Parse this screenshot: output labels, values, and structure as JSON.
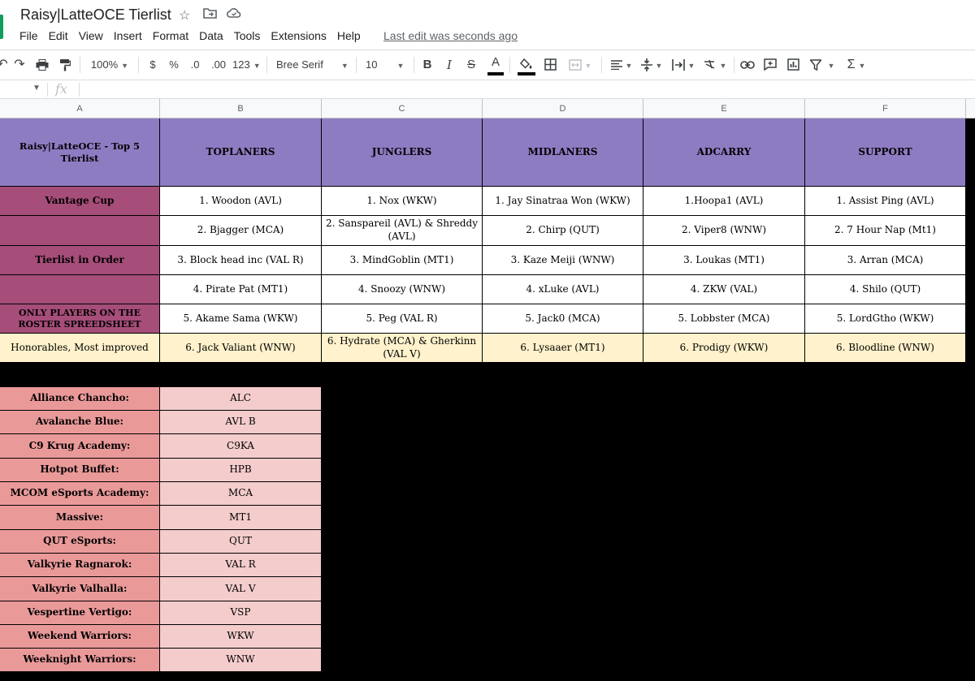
{
  "app": {
    "doc_title": "Raisy|LatteOCE Tierlist",
    "menu": [
      "File",
      "Edit",
      "View",
      "Insert",
      "Format",
      "Data",
      "Tools",
      "Extensions",
      "Help"
    ],
    "last_edit": "Last edit was seconds ago",
    "title_icons": [
      "star-icon",
      "move-to-folder-icon",
      "cloud-saved-icon"
    ]
  },
  "toolbar": {
    "zoom": "100%",
    "currency": "$",
    "percent": "%",
    "dec_decrease": ".0",
    "dec_increase": ".00",
    "more_formats": "123",
    "font": "Bree Serif",
    "font_size": "10"
  },
  "columns": [
    "A",
    "B",
    "C",
    "D",
    "E",
    "F"
  ],
  "sheet": {
    "header": {
      "title": "Raisy|LatteOCE - Top 5 Tierlist",
      "roles": [
        "TOPLANERS",
        "JUNGLERS",
        "MIDLANERS",
        "ADCARRY",
        "SUPPORT"
      ]
    },
    "rows": [
      {
        "label": "Vantage Cup",
        "cells": [
          "1. Woodon (AVL)",
          "1. Nox (WKW)",
          "1. Jay Sinatraa Won (WKW)",
          "1.Hoopa1 (AVL)",
          "1. Assist Ping (AVL)"
        ]
      },
      {
        "label": "",
        "cells": [
          "2. Bjagger (MCA)",
          "2. Sanspareil (AVL) & Shreddy (AVL)",
          "2. Chirp (QUT)",
          "2. Viper8 (WNW)",
          "2. 7 Hour Nap (Mt1)"
        ]
      },
      {
        "label": "Tierlist in Order",
        "cells": [
          "3. Block head inc (VAL R)",
          "3. MindGoblin (MT1)",
          "3. Kaze Meiji (WNW)",
          "3. Loukas (MT1)",
          "3. Arran (MCA)"
        ]
      },
      {
        "label": "",
        "cells": [
          "4. Pirate Pat (MT1)",
          "4. Snoozy (WNW)",
          "4. xLuke (AVL)",
          "4. ZKW (VAL)",
          "4. Shilo (QUT)"
        ]
      },
      {
        "label": "ONLY PLAYERS ON THE ROSTER SPREEDSHEET",
        "cells": [
          "5. Akame Sama (WKW)",
          "5. Peg (VAL R)",
          "5. Jack0 (MCA)",
          "5. Lobbster (MCA)",
          "5. LordGtho (WKW)"
        ]
      }
    ],
    "honorables": {
      "label": "Honorables, Most improved",
      "cells": [
        "6. Jack Valiant (WNW)",
        "6. Hydrate (MCA) & Gherkinn (VAL V)",
        "6. Lysaaer (MT1)",
        "6. Prodigy (WKW)",
        "6. Bloodline (WNW)"
      ]
    },
    "teams": [
      {
        "name": "Alliance Chancho:",
        "abbr": "ALC"
      },
      {
        "name": "Avalanche Blue:",
        "abbr": "AVL B"
      },
      {
        "name": "C9 Krug Academy:",
        "abbr": "C9KA"
      },
      {
        "name": "Hotpot Buffet:",
        "abbr": "HPB"
      },
      {
        "name": "MCOM eSports Academy:",
        "abbr": "MCA"
      },
      {
        "name": "Massive:",
        "abbr": "MT1"
      },
      {
        "name": "QUT eSports:",
        "abbr": "QUT"
      },
      {
        "name": "Valkyrie Ragnarok:",
        "abbr": "VAL R"
      },
      {
        "name": "Valkyrie Valhalla:",
        "abbr": "VAL V"
      },
      {
        "name": "Vespertine Vertigo:",
        "abbr": "VSP"
      },
      {
        "name": "Weekend Warriors:",
        "abbr": "WKW"
      },
      {
        "name": "Weeknight Warriors:",
        "abbr": "WNW"
      }
    ]
  },
  "colors": {
    "header_purple": "#8e7cc3",
    "label_mauve": "#a64d79",
    "honorable_cream": "#fff2cc",
    "team_salmon": "#ea9999",
    "team_pink": "#f4cccc",
    "sheets_green": "#0f9d58"
  }
}
